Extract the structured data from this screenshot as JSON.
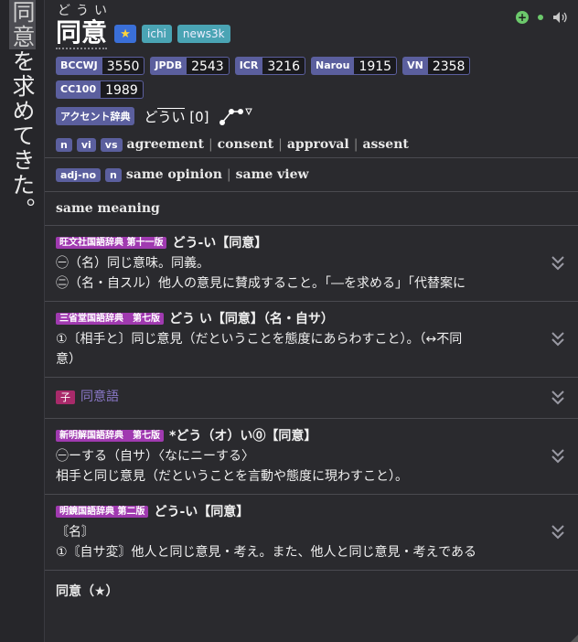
{
  "source_text": {
    "highlight": "同意",
    "rest": "を求めてきた。"
  },
  "entry": {
    "furigana": "どうい",
    "kanji": "同意",
    "tags": [
      "ichi",
      "news3k"
    ],
    "frequencies": [
      {
        "label": "BCCWJ",
        "value": "3550"
      },
      {
        "label": "JPDB",
        "value": "2543"
      },
      {
        "label": "ICR",
        "value": "3216"
      },
      {
        "label": "Narou",
        "value": "1915"
      },
      {
        "label": "VN",
        "value": "2358"
      },
      {
        "label": "CC100",
        "value": "1989"
      }
    ],
    "accent": {
      "label": "アクセント辞典",
      "reading_plain": "ど",
      "reading_over": "うい",
      "number": "[0]"
    },
    "gloss1": {
      "pos": [
        "n",
        "vi",
        "vs"
      ],
      "terms": [
        "agreement",
        "consent",
        "approval",
        "assent"
      ]
    },
    "gloss2": {
      "pos": [
        "adj-no",
        "n"
      ],
      "terms": [
        "same opinion",
        "same view"
      ]
    },
    "gloss3": {
      "text": "same meaning"
    }
  },
  "dicts": [
    {
      "tag": "旺文社国語辞典 第十一版",
      "title": "どう‐い【同意】",
      "lines": [
        "㊀（名）同じ意味。同義。",
        "㊁（名・自スル）他人の意見に賛成すること。「―を求める」「代替案に"
      ]
    },
    {
      "tag": "三省堂国語辞典　第七版",
      "title": "どう い【同意】（名・自サ）",
      "lines": [
        "①〔相手と〕同じ意見（だということを態度にあらわすこと）。（↔不同",
        "意）"
      ]
    }
  ],
  "subentry": {
    "tag": "子",
    "label": "同意語"
  },
  "dicts2": [
    {
      "tag": "新明解国語辞典　第七版",
      "title": "*どう（オ）い⓪【同意】",
      "lines": [
        "㊀ーする（自サ）〈なにニーする〉",
        "相手と同じ意見（だということを言動や態度に現わすこと）。"
      ]
    },
    {
      "tag": "明鏡国語辞典 第二版",
      "title": "どう‐い【同意】",
      "lines": [
        "〘名〙",
        "①〘自サ変〙他人と同じ意見・考え。また、他人と同じ意見・考えである"
      ]
    }
  ],
  "bottom": {
    "text": "同意（★）"
  }
}
